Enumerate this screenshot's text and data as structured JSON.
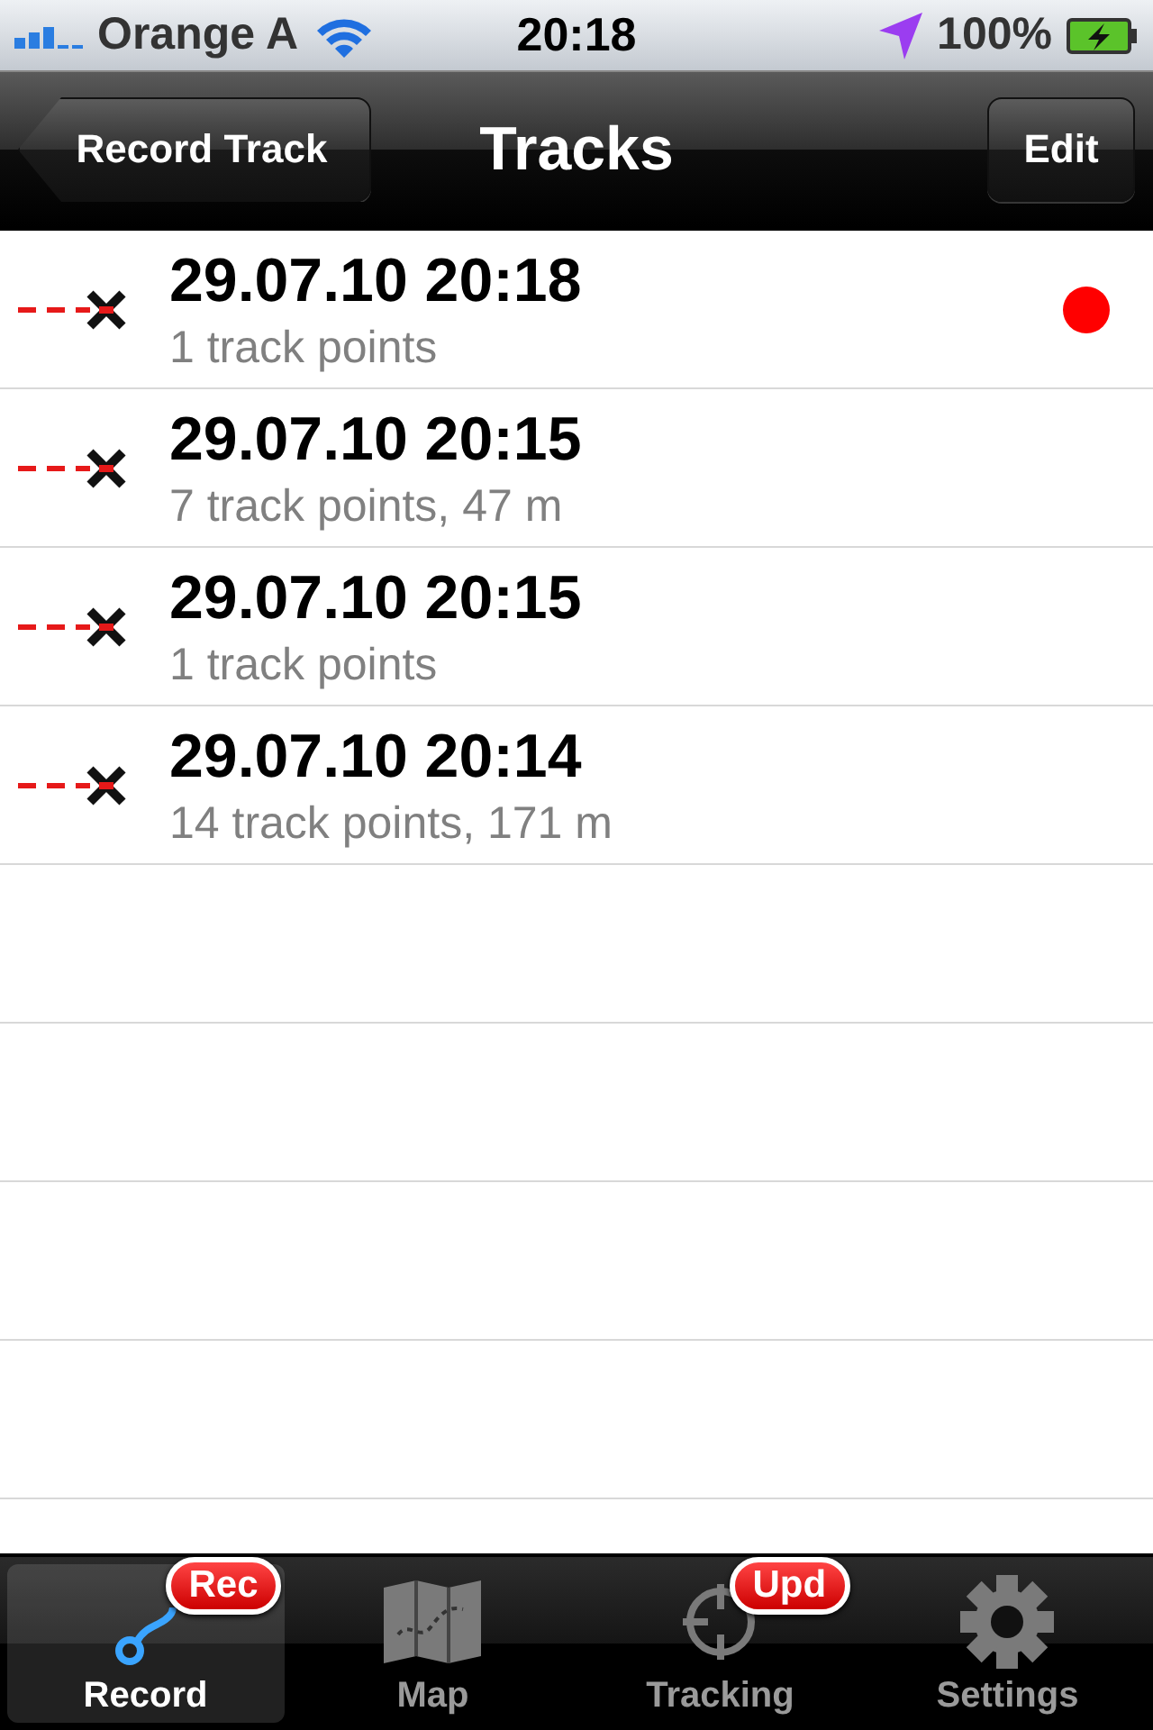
{
  "status_bar": {
    "carrier": "Orange A",
    "time": "20:18",
    "battery": "100%"
  },
  "nav_bar": {
    "back_button": "Record Track",
    "title": "Tracks",
    "edit_button": "Edit"
  },
  "tracks": [
    {
      "title": "29.07.10 20:18",
      "subtitle": "1 track points",
      "recording": true
    },
    {
      "title": "29.07.10 20:15",
      "subtitle": "7 track points, 47 m",
      "recording": false
    },
    {
      "title": "29.07.10 20:15",
      "subtitle": "1 track points",
      "recording": false
    },
    {
      "title": "29.07.10 20:14",
      "subtitle": "14 track points, 171 m",
      "recording": false
    }
  ],
  "tab_bar": [
    {
      "label": "Record",
      "kind": "record",
      "badge": "Rec",
      "selected": true
    },
    {
      "label": "Map",
      "kind": "map",
      "selected": false
    },
    {
      "label": "Tracking",
      "kind": "tracking",
      "badge": "Upd",
      "selected": false
    },
    {
      "label": "Settings",
      "kind": "settings",
      "selected": false
    }
  ]
}
